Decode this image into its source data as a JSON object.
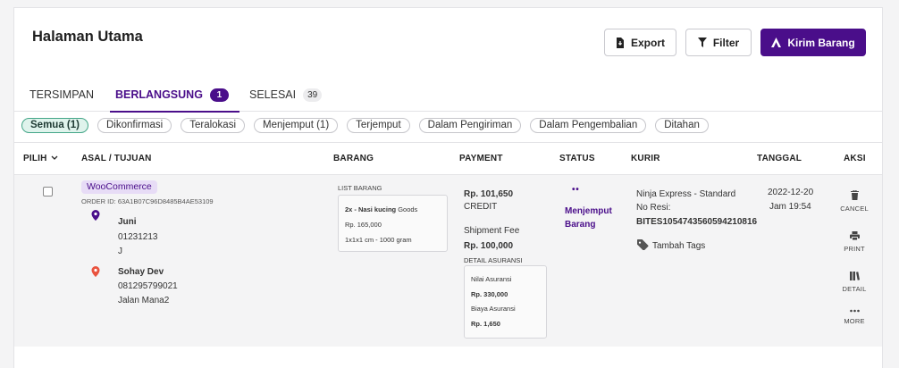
{
  "header": {
    "title": "Halaman Utama",
    "export_label": "Export",
    "filter_label": "Filter",
    "kirim_label": "Kirim Barang"
  },
  "tabs": [
    {
      "label": "TERSIMPAN",
      "count": ""
    },
    {
      "label": "BERLANGSUNG",
      "count": "1"
    },
    {
      "label": "SELESAI",
      "count": "39"
    }
  ],
  "filters": [
    "Semua (1)",
    "Dikonfirmasi",
    "Teralokasi",
    "Menjemput (1)",
    "Terjemput",
    "Dalam Pengiriman",
    "Dalam Pengembalian",
    "Ditahan"
  ],
  "columns": {
    "pilih": "PILIH",
    "asal": "ASAL / TUJUAN",
    "barang": "BARANG",
    "payment": "PAYMENT",
    "status": "STATUS",
    "kurir": "KURIR",
    "tanggal": "TANGGAL",
    "aksi": "AKSI"
  },
  "order": {
    "source": "WooCommerce",
    "order_id": "ORDER ID: 63A1B07C96D8485B4AE53109",
    "sender": {
      "name": "Juni",
      "phone": "01231213",
      "address": "J"
    },
    "receiver": {
      "name": "Sohay Dev",
      "phone": "081295799021",
      "address": "Jalan Mana2"
    },
    "items": {
      "list_label": "LIST BARANG",
      "qty_name": "2x - Nasi kucing",
      "type": "Goods",
      "price": "Rp. 165,000",
      "dimension": "1x1x1 cm - 1000 gram"
    },
    "payment": {
      "total": "Rp. 101,650",
      "method": "CREDIT",
      "fee_label": "Shipment Fee",
      "fee": "Rp. 100,000",
      "insurance_label": "DETAIL ASURANSI",
      "insured_value_label": "Nilai Asuransi",
      "insured_value": "Rp. 330,000",
      "insurance_cost_label": "Biaya Asuransi",
      "insurance_cost": "Rp. 1,650"
    },
    "status": {
      "dots": "• •",
      "text": "Menjemput Barang"
    },
    "courier": {
      "service": "Ninja Express - Standard",
      "resi_label": "No Resi:",
      "resi": "BITES1054743560594210816",
      "tag_label": "Tambah Tags"
    },
    "date": {
      "day": "2022-12-20",
      "time": "Jam 19:54"
    },
    "actions": [
      "CANCEL",
      "PRINT",
      "DETAIL",
      "MORE"
    ]
  },
  "colors": {
    "accent": "#4a0e8a",
    "active_chip": "#dff3ec",
    "sender_pin": "#4a0e8a",
    "receiver_pin": "#e9533f"
  }
}
